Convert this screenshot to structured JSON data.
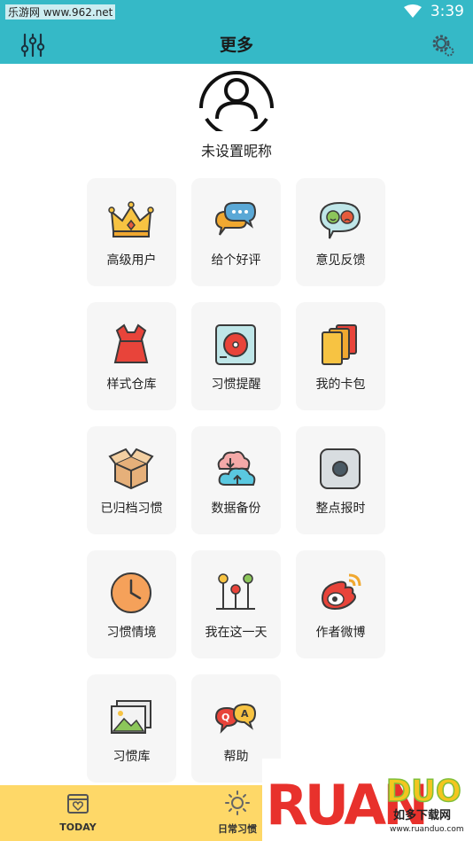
{
  "status_bar": {
    "watermark": "乐游网 www.962.net",
    "time": "3:39"
  },
  "app_bar": {
    "title": "更多",
    "left_icon": "sliders-icon",
    "right_icon": "settings-gear-icon"
  },
  "profile": {
    "nickname": "未设置昵称"
  },
  "menu": {
    "items": [
      {
        "label": "高级用户",
        "icon": "crown-icon"
      },
      {
        "label": "给个好评",
        "icon": "chat-bubbles-icon"
      },
      {
        "label": "意见反馈",
        "icon": "feedback-faces-icon"
      },
      {
        "label": "样式仓库",
        "icon": "dress-icon"
      },
      {
        "label": "习惯提醒",
        "icon": "alarm-clock-icon"
      },
      {
        "label": "我的卡包",
        "icon": "cards-icon"
      },
      {
        "label": "已归档习惯",
        "icon": "open-box-icon"
      },
      {
        "label": "数据备份",
        "icon": "cloud-sync-icon"
      },
      {
        "label": "整点报时",
        "icon": "record-button-icon"
      },
      {
        "label": "习惯情境",
        "icon": "clock-icon"
      },
      {
        "label": "我在这一天",
        "icon": "timeline-pins-icon"
      },
      {
        "label": "作者微博",
        "icon": "weibo-icon"
      },
      {
        "label": "习惯库",
        "icon": "photo-gallery-icon"
      },
      {
        "label": "帮助",
        "icon": "qa-bubbles-icon"
      }
    ]
  },
  "tab_bar": {
    "tabs": [
      {
        "label": "TODAY",
        "icon": "calendar-heart-icon"
      },
      {
        "label": "日常习惯",
        "icon": "sun-icon"
      }
    ]
  },
  "overlay_logo": {
    "text": "RUANDUO",
    "subtitle": "如多下载网",
    "url": "www.ruanduo.com"
  }
}
